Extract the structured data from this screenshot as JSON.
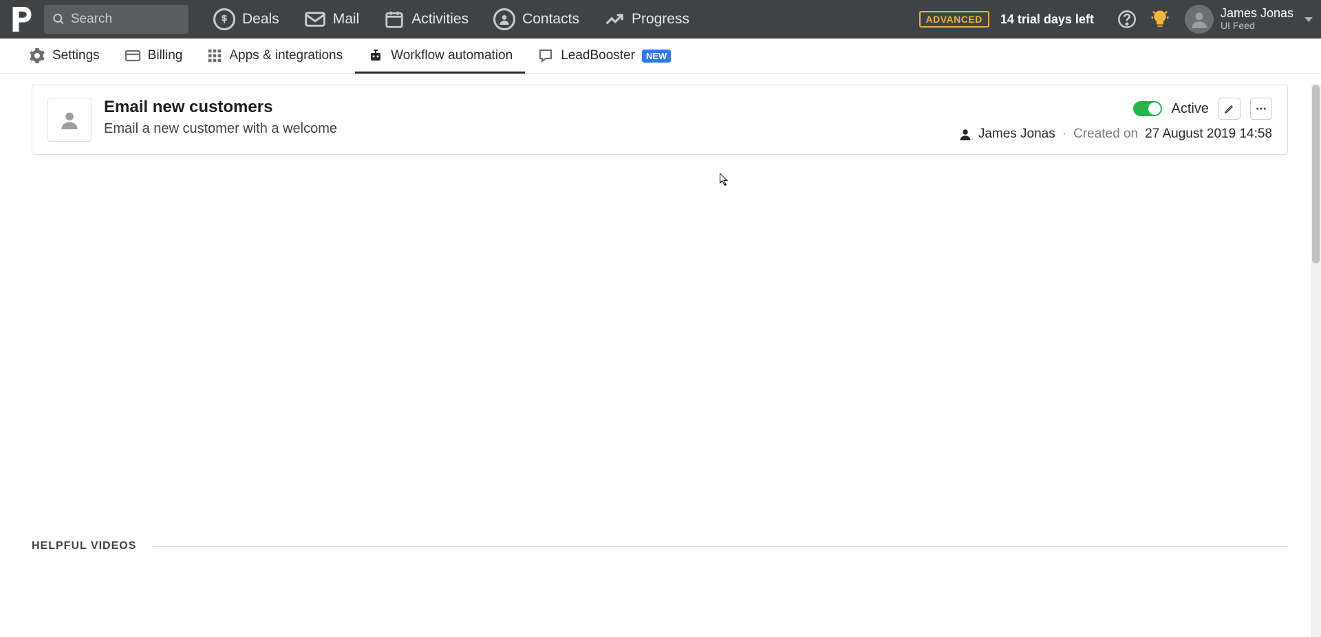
{
  "search": {
    "placeholder": "Search"
  },
  "nav": {
    "deals": "Deals",
    "mail": "Mail",
    "activities": "Activities",
    "contacts": "Contacts",
    "progress": "Progress"
  },
  "trial": {
    "badge": "ADVANCED",
    "text": "14 trial days left"
  },
  "user": {
    "name": "James Jonas",
    "sub": "UI Feed"
  },
  "subnav": {
    "settings": "Settings",
    "billing": "Billing",
    "apps": "Apps & integrations",
    "workflow": "Workflow automation",
    "leadbooster": "LeadBooster",
    "new_badge": "new"
  },
  "workflow_card": {
    "title": "Email new customers",
    "desc": "Email a new customer with a welcome",
    "status": "Active",
    "author": "James Jonas",
    "created_label": "Created on",
    "created_value": "27 August 2019 14:58"
  },
  "section": {
    "helpful_videos": "Helpful Videos"
  }
}
